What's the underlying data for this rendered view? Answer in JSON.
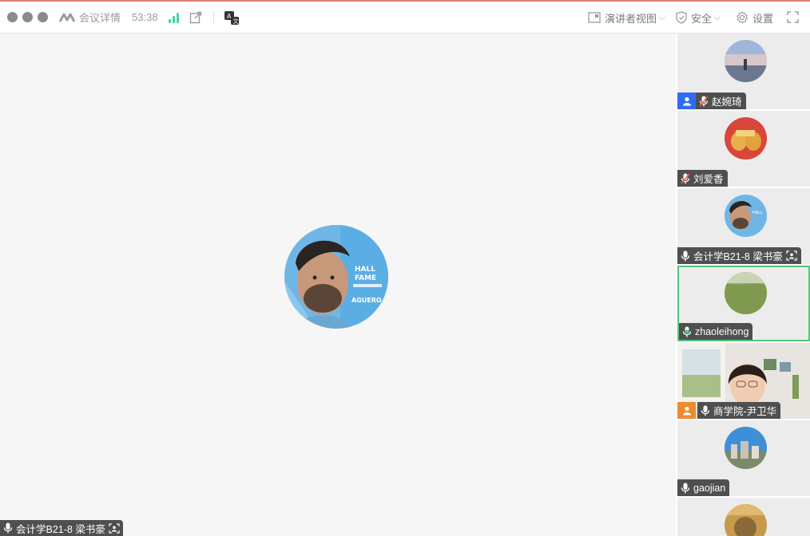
{
  "window": {
    "title": "会议详情",
    "timer": "53:38",
    "view_mode": "演讲者视图",
    "security": "安全",
    "settings": "设置"
  },
  "colors": {
    "accent_blue": "#2f6cf6",
    "active_speaker_border": "#55c57a",
    "signal_green": "#4cd2a6",
    "host_badge_orange": "#f08a2c"
  },
  "main": {
    "speaker_label": "会计学B21-8 梁书豪",
    "icons": [
      "mic-icon",
      "screen-share-icon"
    ]
  },
  "participants": [
    {
      "name": "赵婉琦",
      "badge": "user-icon",
      "badge_color": "#2f6cf6",
      "mic": "muted"
    },
    {
      "name": "刘爱香",
      "mic": "muted"
    },
    {
      "name": "会计学B21-8 梁书豪",
      "mic": "on",
      "sharing": true
    },
    {
      "name": "zhaoleihong",
      "mic": "speaking",
      "active": true
    },
    {
      "name": "商学院-尹卫华",
      "badge": "user-icon",
      "badge_color": "#f08a2c",
      "mic": "on",
      "video": true
    },
    {
      "name": "gaojian",
      "mic": "on"
    }
  ]
}
